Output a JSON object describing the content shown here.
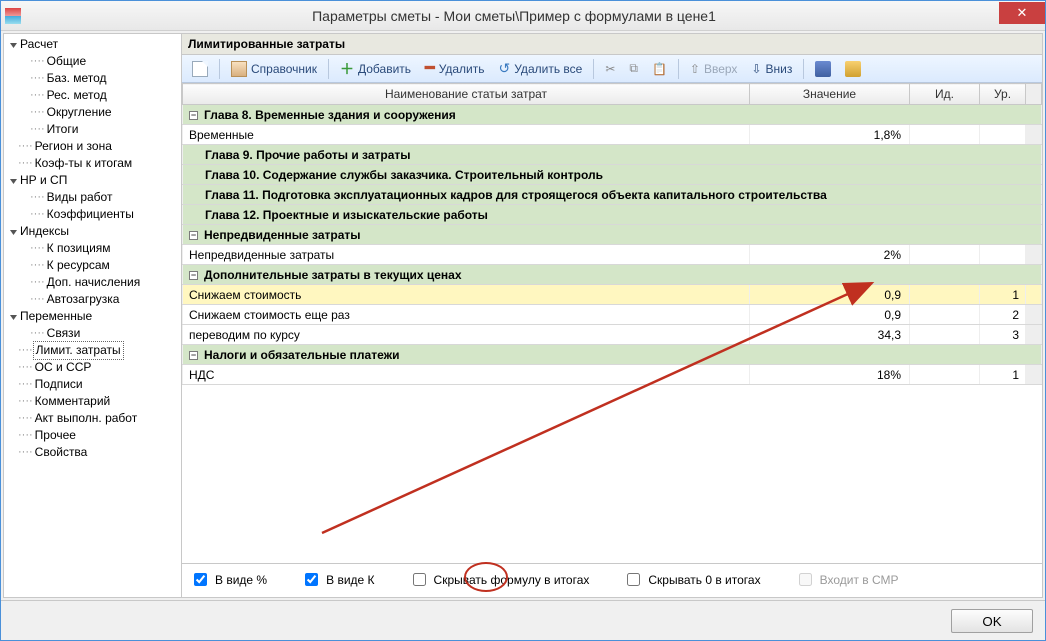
{
  "window": {
    "title": "Параметры сметы - Мои сметы\\Пример с формулами в цене1"
  },
  "tree": {
    "items": [
      {
        "label": "Расчет",
        "depth": 0,
        "exp": "▾"
      },
      {
        "label": "Общие",
        "depth": 1,
        "leaf": true
      },
      {
        "label": "Баз. метод",
        "depth": 1,
        "leaf": true
      },
      {
        "label": "Рес. метод",
        "depth": 1,
        "leaf": true
      },
      {
        "label": "Округление",
        "depth": 1,
        "leaf": true
      },
      {
        "label": "Итоги",
        "depth": 1,
        "leaf": true
      },
      {
        "label": "Регион и зона",
        "depth": 0,
        "leaf": true
      },
      {
        "label": "Коэф-ты к итогам",
        "depth": 0,
        "leaf": true
      },
      {
        "label": "НР и СП",
        "depth": 0,
        "exp": "▾"
      },
      {
        "label": "Виды работ",
        "depth": 1,
        "leaf": true
      },
      {
        "label": "Коэффициенты",
        "depth": 1,
        "leaf": true
      },
      {
        "label": "Индексы",
        "depth": 0,
        "exp": "▾"
      },
      {
        "label": "К позициям",
        "depth": 1,
        "leaf": true
      },
      {
        "label": "К ресурсам",
        "depth": 1,
        "leaf": true
      },
      {
        "label": "Доп. начисления",
        "depth": 1,
        "leaf": true
      },
      {
        "label": "Автозагрузка",
        "depth": 1,
        "leaf": true
      },
      {
        "label": "Переменные",
        "depth": 0,
        "exp": "▾"
      },
      {
        "label": "Связи",
        "depth": 1,
        "leaf": true
      },
      {
        "label": "Лимит. затраты",
        "depth": 0,
        "leaf": true,
        "selected": true
      },
      {
        "label": "ОС и ССР",
        "depth": 0,
        "leaf": true
      },
      {
        "label": "Подписи",
        "depth": 0,
        "leaf": true
      },
      {
        "label": "Комментарий",
        "depth": 0,
        "leaf": true
      },
      {
        "label": "Акт выполн. работ",
        "depth": 0,
        "leaf": true
      },
      {
        "label": "Прочее",
        "depth": 0,
        "leaf": true
      },
      {
        "label": "Свойства",
        "depth": 0,
        "leaf": true
      }
    ]
  },
  "panel": {
    "title": "Лимитированные затраты"
  },
  "toolbar": {
    "reference": "Справочник",
    "add": "Добавить",
    "delete": "Удалить",
    "delete_all": "Удалить все",
    "up": "Вверх",
    "down": "Вниз"
  },
  "grid": {
    "headers": {
      "name": "Наименование статьи затрат",
      "value": "Значение",
      "id": "Ид.",
      "level": "Ур."
    },
    "rows": [
      {
        "type": "group",
        "name": "Глава 8. Временные здания и сооружения"
      },
      {
        "type": "data",
        "name": "Временные",
        "value": "1,8%",
        "id": "",
        "level": ""
      },
      {
        "type": "subhead",
        "name": "Глава 9. Прочие работы и затраты"
      },
      {
        "type": "subhead",
        "name": "Глава 10. Содержание службы заказчика. Строительный контроль"
      },
      {
        "type": "subhead",
        "name": "Глава 11. Подготовка эксплуатационных кадров для строящегося объекта капитального строительства"
      },
      {
        "type": "subhead",
        "name": "Глава 12. Проектные и изыскательские работы"
      },
      {
        "type": "group",
        "name": "Непредвиденные затраты"
      },
      {
        "type": "data",
        "name": "Непредвиденные затраты",
        "value": "2%",
        "id": "",
        "level": ""
      },
      {
        "type": "group",
        "name": "Дополнительные затраты в текущих ценах"
      },
      {
        "type": "data",
        "name": "Снижаем стоимость",
        "value": "0,9",
        "id": "",
        "level": "1",
        "selected": true
      },
      {
        "type": "data",
        "name": "Снижаем стоимость еще раз",
        "value": "0,9",
        "id": "",
        "level": "2"
      },
      {
        "type": "data",
        "name": "переводим по курсу",
        "value": "34,3",
        "id": "",
        "level": "3"
      },
      {
        "type": "group",
        "name": "Налоги и обязательные платежи"
      },
      {
        "type": "data",
        "name": "НДС",
        "value": "18%",
        "id": "",
        "level": "1"
      }
    ]
  },
  "options": {
    "percent": "В виде %",
    "coeff": "В виде К",
    "hide_formula": "Скрывать формулу в итогах",
    "hide_zero": "Скрывать 0 в итогах",
    "in_smr": "Входит в СМР"
  },
  "footer": {
    "ok": "OK"
  }
}
